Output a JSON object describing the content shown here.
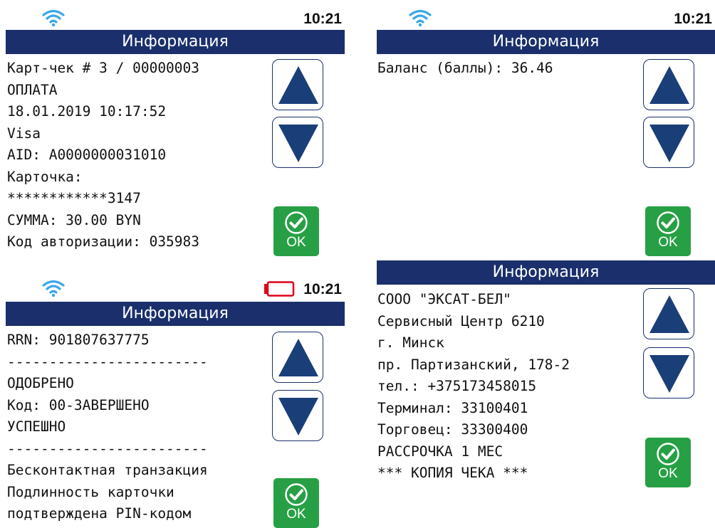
{
  "screens": [
    {
      "status": {
        "time": "10:21",
        "wifi_icon": "wifi-icon"
      },
      "title": "Информация",
      "lines": [
        "Карт-чек # 3 / 00000003",
        "ОПЛАТА",
        "18.01.2019 10:17:52",
        "Visa",
        "AID: A0000000031010",
        "Карточка:",
        "************3147",
        "СУММА: 30.00 BYN",
        "Код авторизации: 035983"
      ],
      "ok_label": "OK"
    },
    {
      "status": {
        "time": "10:21",
        "wifi_icon": "wifi-icon"
      },
      "title": "Информация",
      "lines": [
        "Баланс (баллы): 36.46"
      ],
      "ok_label": "OK"
    },
    {
      "status": {
        "time": "10:21",
        "wifi_icon": "wifi-icon",
        "battery_icon": "battery-low-icon",
        "battery_color": "#e0001b"
      },
      "title": "Информация",
      "lines": [
        "RRN: 901807637775",
        "------------------------",
        "ОДОБРЕНО",
        "Код: 00-ЗАВЕРШЕНО",
        "УСПЕШНО",
        "------------------------",
        "Бесконтактная транзакция",
        "Подлинность карточки",
        "подтверждена PIN-кодом"
      ],
      "ok_label": "OK"
    },
    {
      "title": "Информация",
      "lines": [
        "СООО \"ЭКСАТ-БЕЛ\"",
        "Сервисный Центр 6210",
        "г. Минск",
        "пр. Партизанский, 178-2",
        "тел.: +375173458015",
        "Терминал: 33100401",
        "Торговец: 33300400",
        "РАССРОЧКА 1 МЕС",
        "*** КОПИЯ ЧЕКА ***"
      ],
      "ok_label": "OK"
    }
  ],
  "colors": {
    "titlebar": "#1a2f6b",
    "arrow": "#1a3e78",
    "ok": "#27a045",
    "wifi": "#3aa6e8"
  }
}
